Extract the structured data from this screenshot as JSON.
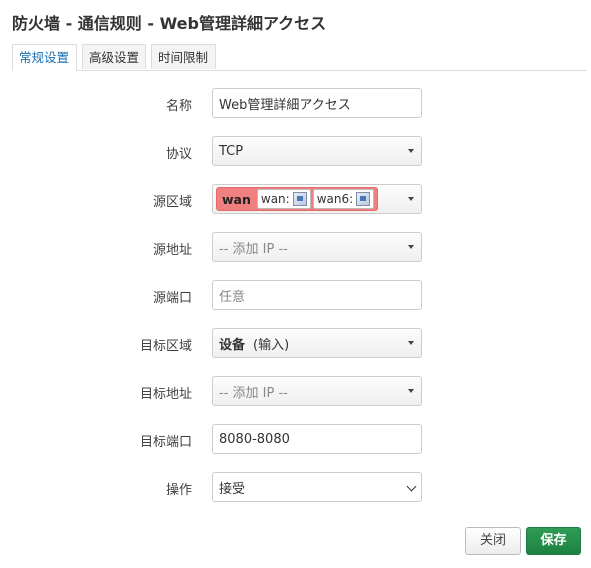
{
  "page": {
    "title": "防火墙 - 通信规则 - Web管理詳細アクセス"
  },
  "tabs": [
    {
      "label": "常规设置",
      "active": true
    },
    {
      "label": "高级设置",
      "active": false
    },
    {
      "label": "时间限制",
      "active": false
    }
  ],
  "form": {
    "name": {
      "label": "名称",
      "value": "Web管理詳細アクセス"
    },
    "protocol": {
      "label": "协议",
      "value": "TCP"
    },
    "src_zone": {
      "label": "源区域",
      "zone": "wan",
      "interfaces": [
        {
          "name": "wan:",
          "icon": "network-interface-icon"
        },
        {
          "name": "wan6:",
          "icon": "network-interface-icon"
        }
      ],
      "zone_color": "#f08080"
    },
    "src_addr": {
      "label": "源地址",
      "placeholder": "-- 添加 IP --"
    },
    "src_port": {
      "label": "源端口",
      "placeholder": "任意"
    },
    "dest_zone": {
      "label": "目标区域",
      "device": "设备",
      "direction": "(输入)"
    },
    "dest_addr": {
      "label": "目标地址",
      "placeholder": "-- 添加 IP --"
    },
    "dest_port": {
      "label": "目标端口",
      "value": "8080-8080"
    },
    "action": {
      "label": "操作",
      "value": "接受"
    }
  },
  "buttons": {
    "close": "关闭",
    "save": "保存",
    "save_color": "#1e8141"
  }
}
